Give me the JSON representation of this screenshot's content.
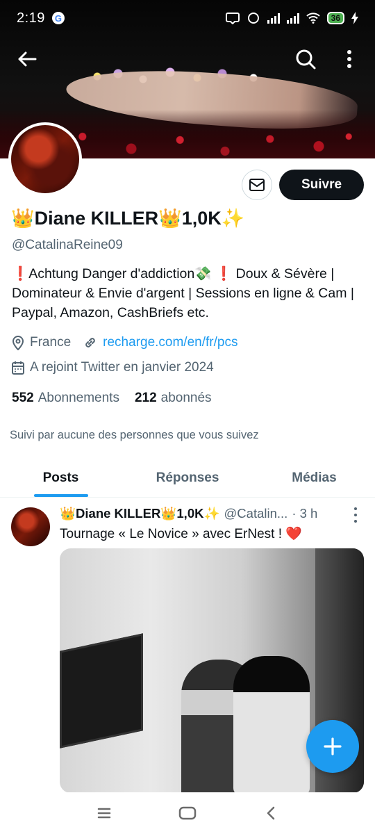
{
  "status_bar": {
    "time": "2:19",
    "google_icon_letter": "G",
    "battery": "36"
  },
  "profile": {
    "name": "👑Diane KILLER👑1,0K✨",
    "handle": "@CatalinaReine09",
    "bio": "❗Achtung Danger d'addiction💸 ❗ Doux & Sévère | Dominateur & Envie d'argent | Sessions en ligne & Cam | Paypal, Amazon, CashBriefs etc.",
    "location": "France",
    "link": "recharge.com/en/fr/pcs",
    "joined": "A rejoint Twitter en janvier 2024",
    "following_count": "552",
    "following_label": "Abonnements",
    "followers_count": "212",
    "followers_label": "abonnés",
    "followed_by": "Suivi par aucune des personnes que vous suivez",
    "follow_button": "Suivre"
  },
  "tabs": [
    {
      "label": "Posts",
      "active": true
    },
    {
      "label": "Réponses",
      "active": false
    },
    {
      "label": "Médias",
      "active": false
    }
  ],
  "post": {
    "author_name": "👑Diane KILLER👑1,0K✨",
    "author_handle": "@Catalin...",
    "time": "· 3 h",
    "text": "Tournage « Le Novice » avec ErNest ! ❤️"
  },
  "icons": {
    "back": "back-arrow-icon",
    "search": "search-icon",
    "more": "more-vertical-icon",
    "mail": "mail-icon",
    "location": "location-pin-icon",
    "link": "link-icon",
    "calendar": "calendar-icon",
    "compose": "plus-icon"
  },
  "colors": {
    "accent": "#1d9bf0",
    "text_primary": "#0f1419",
    "text_secondary": "#536471",
    "follow_button_bg": "#0f1419"
  }
}
